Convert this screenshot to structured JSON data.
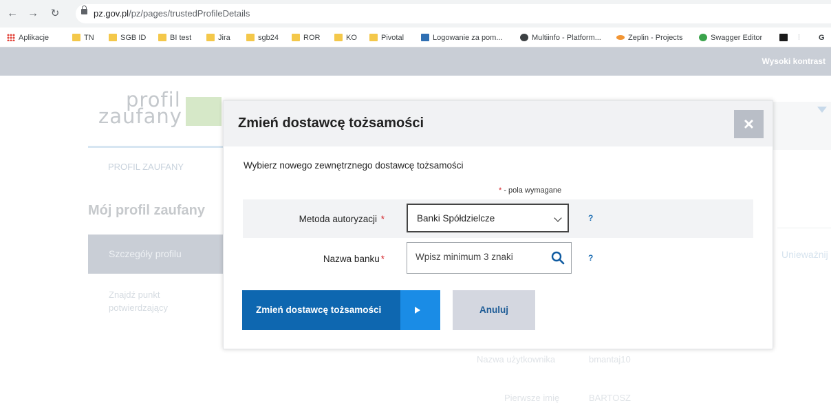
{
  "browser": {
    "url_host": "pz.gov.pl",
    "url_path": "/pz/pages/trustedProfileDetails",
    "bookmarks": [
      {
        "label": "Aplikacje",
        "icon": "apps-grid-icon"
      },
      {
        "label": "TN",
        "icon": "folder-icon"
      },
      {
        "label": "SGB ID",
        "icon": "folder-icon"
      },
      {
        "label": "BI test",
        "icon": "folder-icon"
      },
      {
        "label": "Jira",
        "icon": "folder-icon"
      },
      {
        "label": "sgb24",
        "icon": "folder-icon"
      },
      {
        "label": "ROR",
        "icon": "folder-icon"
      },
      {
        "label": "KO",
        "icon": "folder-icon"
      },
      {
        "label": "Pivotal",
        "icon": "folder-icon"
      },
      {
        "label": "Logowanie za pom...",
        "icon": "site-icon"
      },
      {
        "label": "Multiinfo - Platform...",
        "icon": "globe-icon"
      },
      {
        "label": "Zeplin - Projects",
        "icon": "zeplin-icon"
      },
      {
        "label": "Swagger Editor",
        "icon": "swagger-icon"
      },
      {
        "label": "",
        "icon": "bookmark-icon"
      },
      {
        "label": "G",
        "icon": "extension-icon"
      }
    ]
  },
  "page": {
    "high_contrast": "Wysoki kontrast",
    "logo_line1": "profil",
    "logo_line2": "zaufany",
    "tab_label": "PROFIL ZAUFANY",
    "heading": "Mój profil zaufany",
    "side_active": "Szczegóły profilu",
    "side_item_line1": "Znajdź punkt",
    "side_item_line2": "potwierdzający",
    "revoke": "Unieważnij",
    "username_label": "Nazwa użytkownika",
    "username_value": "bmantaj10",
    "firstname_label": "Pierwsze imię",
    "firstname_value": "BARTOSZ"
  },
  "modal": {
    "title": "Zmień dostawcę tożsamości",
    "close_symbol": "×",
    "subtitle": "Wybierz nowego zewnętrznego dostawcę tożsamości",
    "required_star": "*",
    "required_text": " - pola wymagane",
    "auth_method_label": "Metoda autoryzacji",
    "auth_method_value": "Banki Spółdzielcze",
    "bank_name_label": "Nazwa banku",
    "bank_name_placeholder": "Wpisz minimum 3 znaki",
    "bank_name_value": "",
    "help_symbol": "?",
    "submit_label": "Zmień dostawcę tożsamości",
    "cancel_label": "Anuluj"
  },
  "colors": {
    "primary": "#0e67b0",
    "primary_accent": "#1a8ce6",
    "required": "#d4242a",
    "help": "#1f6fb4"
  }
}
